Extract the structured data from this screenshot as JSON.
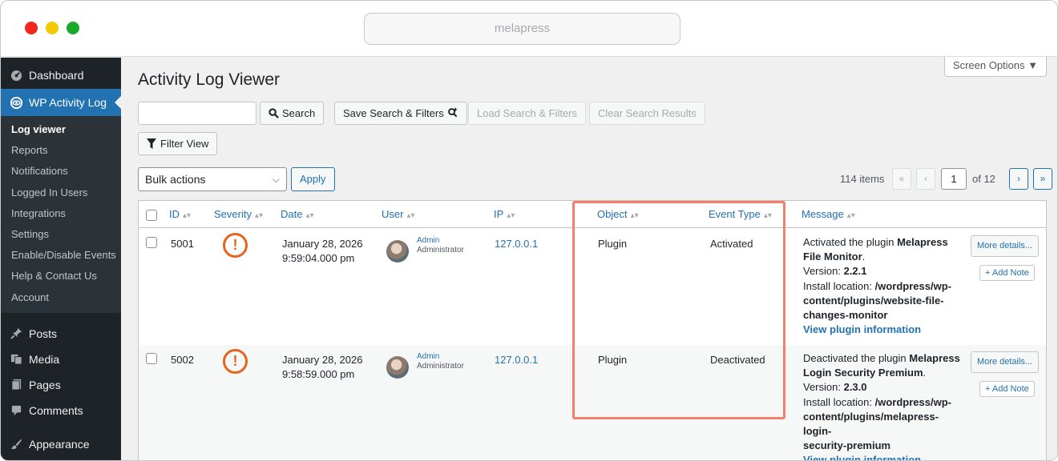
{
  "browser": {
    "url": "melapress"
  },
  "sidebar": {
    "top_items": [
      {
        "label": "Dashboard",
        "icon": "dashboard-icon"
      },
      {
        "label": "WP Activity Log",
        "icon": "wp-activity-log-icon"
      }
    ],
    "sub_items": [
      {
        "label": "Log viewer"
      },
      {
        "label": "Reports"
      },
      {
        "label": "Notifications"
      },
      {
        "label": "Logged In Users"
      },
      {
        "label": "Integrations"
      },
      {
        "label": "Settings"
      },
      {
        "label": "Enable/Disable Events"
      },
      {
        "label": "Help & Contact Us"
      },
      {
        "label": "Account"
      }
    ],
    "bottom_items": [
      {
        "label": "Posts",
        "icon": "pushpin-icon"
      },
      {
        "label": "Media",
        "icon": "media-icon"
      },
      {
        "label": "Pages",
        "icon": "pages-icon"
      },
      {
        "label": "Comments",
        "icon": "comment-icon"
      },
      {
        "label": "Appearance",
        "icon": "appearance-icon"
      }
    ]
  },
  "header": {
    "screen_options": "Screen Options ▼",
    "title": "Activity Log Viewer"
  },
  "toolbar": {
    "search_label": "Search",
    "save_label": "Save Search & Filters",
    "load_label": "Load Search & Filters",
    "clear_label": "Clear Search Results",
    "filter_label": "Filter View",
    "bulk_actions": "Bulk actions",
    "apply_label": "Apply"
  },
  "pagination": {
    "items": "114 items",
    "first": "«",
    "prev": "‹",
    "current": "1",
    "of": "of 12",
    "next": "›",
    "last": "»"
  },
  "table": {
    "columns": [
      "ID",
      "Severity",
      "Date",
      "User",
      "IP",
      "Object",
      "Event Type",
      "Message"
    ],
    "rows": [
      {
        "id": "5001",
        "date_line1": "January 28, 2026",
        "date_line2": "9:59:04.000 pm",
        "user_name": "Admin",
        "user_role": "Administrator",
        "ip": "127.0.0.1",
        "object": "Plugin",
        "event_type": "Activated",
        "msg_prefix": "Activated the plugin ",
        "msg_plugin": "Melapress File Monitor",
        "version_label": "Version: ",
        "version": "2.2.1",
        "location_label": "Install location: ",
        "location_line1": "/wordpress/wp-",
        "location_line2": "content/plugins/website-file-",
        "location_line3": "changes-monitor",
        "info_link": "View plugin information"
      },
      {
        "id": "5002",
        "date_line1": "January 28, 2026",
        "date_line2": "9:58:59.000 pm",
        "user_name": "Admin",
        "user_role": "Administrator",
        "ip": "127.0.0.1",
        "object": "Plugin",
        "event_type": "Deactivated",
        "msg_prefix": "Deactivated the plugin ",
        "msg_plugin": "Melapress Login Security Premium",
        "version_label": "Version: ",
        "version": "2.3.0",
        "location_label": "Install location: ",
        "location_line1": "/wordpress/wp-",
        "location_line2": "content/plugins/melapress-login-",
        "location_line3": "security-premium",
        "info_link": "View plugin information"
      }
    ],
    "more_details": "More details...",
    "add_note": "+ Add Note",
    "severity_glyph": "!"
  },
  "colors": {
    "accent": "#2271b1",
    "sidebar": "#1d2327",
    "severity": "#e6641c",
    "highlight": "#f47f6b"
  }
}
